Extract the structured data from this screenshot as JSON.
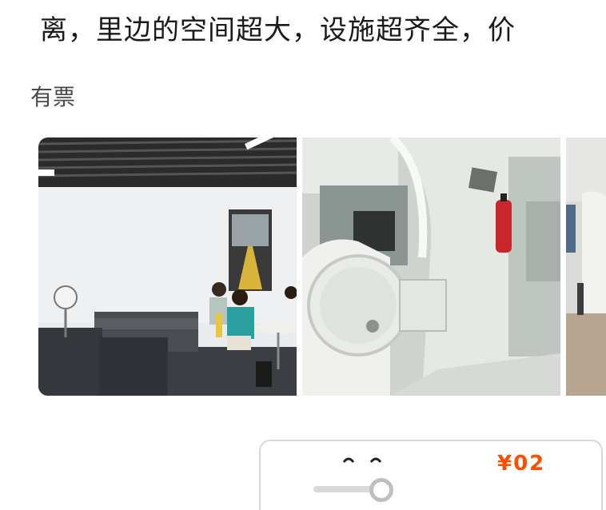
{
  "review": {
    "text": "离，里边的空间超大，设施超齐全，价"
  },
  "ticket_tag": "有票",
  "gallery": {
    "photos": [
      {
        "name": "lounge-area-photo"
      },
      {
        "name": "capsule-pod-interior-photo"
      },
      {
        "name": "capsule-corridor-photo"
      }
    ]
  },
  "price_card": {
    "price": "¥02",
    "slider_level": 1.0
  }
}
